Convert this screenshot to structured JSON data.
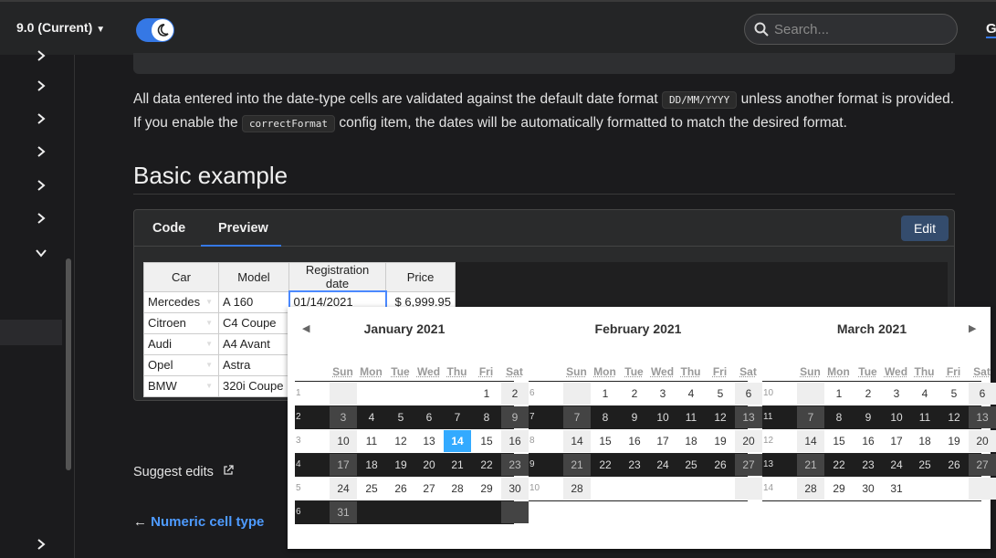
{
  "navbar": {
    "version": "9.0 (Current)",
    "search_placeholder": "Search...",
    "github_label": "G"
  },
  "content": {
    "para_1": "All data entered into the date-type cells are validated against the default date format",
    "code_1": "DD/MM/YYYY",
    "para_2": "unless another format is provided. If you enable the",
    "code_2": "correctFormat",
    "para_3": "config item, the dates will be automatically formatted to match the desired format.",
    "section_title": "Basic example",
    "tab_code": "Code",
    "tab_preview": "Preview",
    "edit_label": "Edit",
    "suggest_edits": "Suggest edits",
    "prev_arrow": "←",
    "prev_link": "Numeric cell type"
  },
  "table": {
    "headers": [
      "Car",
      "Model",
      "Registration date",
      "Price"
    ],
    "rows": [
      [
        "Mercedes",
        "A 160",
        "01/14/2021",
        "$ 6,999.95"
      ],
      [
        "Citroen",
        "C4 Coupe",
        "",
        ""
      ],
      [
        "Audi",
        "A4 Avant",
        "",
        ""
      ],
      [
        "Opel",
        "Astra",
        "",
        ""
      ],
      [
        "BMW",
        "320i Coupe",
        "",
        ""
      ]
    ]
  },
  "datepicker": {
    "weekdays": [
      "Sun",
      "Mon",
      "Tue",
      "Wed",
      "Thu",
      "Fri",
      "Sat"
    ],
    "months": [
      {
        "title": "January 2021",
        "weeks": [
          {
            "num": "1",
            "days": [
              "",
              "",
              "",
              "",
              "",
              "1",
              "2"
            ]
          },
          {
            "num": "2",
            "days": [
              "3",
              "4",
              "5",
              "6",
              "7",
              "8",
              "9"
            ]
          },
          {
            "num": "3",
            "days": [
              "10",
              "11",
              "12",
              "13",
              "14",
              "15",
              "16"
            ]
          },
          {
            "num": "4",
            "days": [
              "17",
              "18",
              "19",
              "20",
              "21",
              "22",
              "23"
            ]
          },
          {
            "num": "5",
            "days": [
              "24",
              "25",
              "26",
              "27",
              "28",
              "29",
              "30"
            ]
          },
          {
            "num": "6",
            "days": [
              "31",
              "",
              "",
              "",
              "",
              "",
              ""
            ]
          }
        ],
        "selected_day": "14"
      },
      {
        "title": "February 2021",
        "weeks": [
          {
            "num": "6",
            "days": [
              "",
              "1",
              "2",
              "3",
              "4",
              "5",
              "6"
            ]
          },
          {
            "num": "7",
            "days": [
              "7",
              "8",
              "9",
              "10",
              "11",
              "12",
              "13"
            ]
          },
          {
            "num": "8",
            "days": [
              "14",
              "15",
              "16",
              "17",
              "18",
              "19",
              "20"
            ]
          },
          {
            "num": "9",
            "days": [
              "21",
              "22",
              "23",
              "24",
              "25",
              "26",
              "27"
            ]
          },
          {
            "num": "10",
            "days": [
              "28",
              "",
              "",
              "",
              "",
              "",
              ""
            ]
          }
        ]
      },
      {
        "title": "March 2021",
        "weeks": [
          {
            "num": "10",
            "days": [
              "",
              "1",
              "2",
              "3",
              "4",
              "5",
              "6"
            ]
          },
          {
            "num": "11",
            "days": [
              "7",
              "8",
              "9",
              "10",
              "11",
              "12",
              "13"
            ]
          },
          {
            "num": "12",
            "days": [
              "14",
              "15",
              "16",
              "17",
              "18",
              "19",
              "20"
            ]
          },
          {
            "num": "13",
            "days": [
              "21",
              "22",
              "23",
              "24",
              "25",
              "26",
              "27"
            ]
          },
          {
            "num": "14",
            "days": [
              "28",
              "29",
              "30",
              "31",
              "",
              "",
              ""
            ]
          }
        ]
      }
    ]
  }
}
